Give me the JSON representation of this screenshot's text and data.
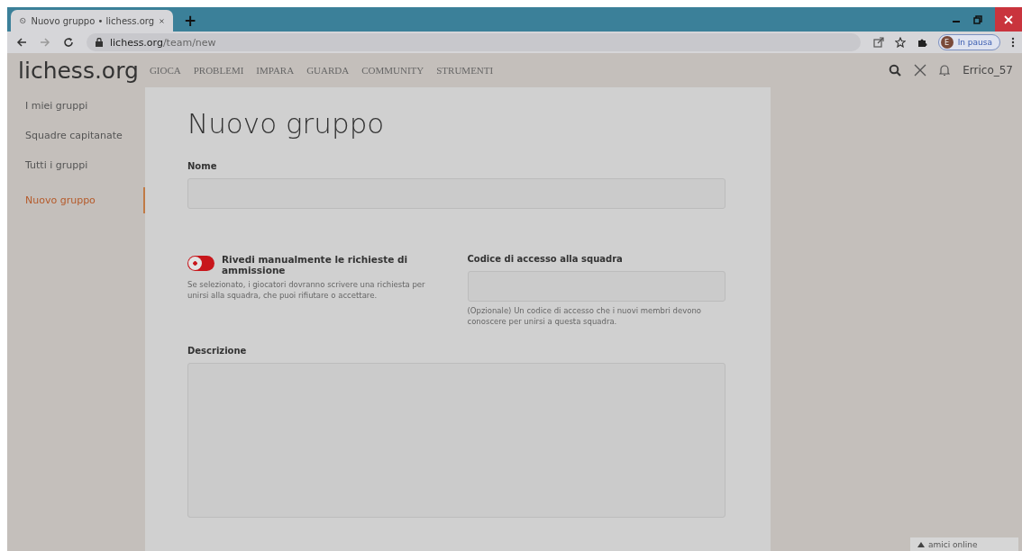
{
  "browser": {
    "tab": {
      "title": "Nuovo gruppo • lichess.org",
      "selected": true
    },
    "new_tab": "+",
    "address": {
      "host": "lichess.org",
      "path": "/team/new"
    },
    "profile": {
      "initial": "E",
      "label": "In pausa"
    }
  },
  "site": {
    "logo": {
      "main": "lichess",
      "suffix": ".org"
    },
    "nav": [
      "GIOCA",
      "PROBLEMI",
      "IMPARA",
      "GUARDA",
      "COMMUNITY",
      "STRUMENTI"
    ],
    "user": "Errico_57"
  },
  "sidebar": {
    "items": [
      {
        "label": "I miei gruppi",
        "selected": false
      },
      {
        "label": "Squadre capitanate",
        "selected": false
      },
      {
        "label": "Tutti i gruppi",
        "selected": false
      },
      {
        "label": "Nuovo gruppo",
        "selected": true
      }
    ]
  },
  "form": {
    "title": "Nuovo gruppo",
    "name_label": "Nome",
    "toggle": {
      "label": "Rivedi manualmente le richieste di ammissione",
      "on": false,
      "help": "Se selezionato, i giocatori dovranno scrivere una richiesta per unirsi alla squadra, che puoi rifiutare o accettare."
    },
    "password": {
      "label": "Codice di accesso alla squadra",
      "help": "(Opzionale) Un codice di accesso che i nuovi membri devono conoscere per unirsi a questa squadra."
    },
    "description_label": "Descrizione"
  },
  "friends_bar": "amici online"
}
